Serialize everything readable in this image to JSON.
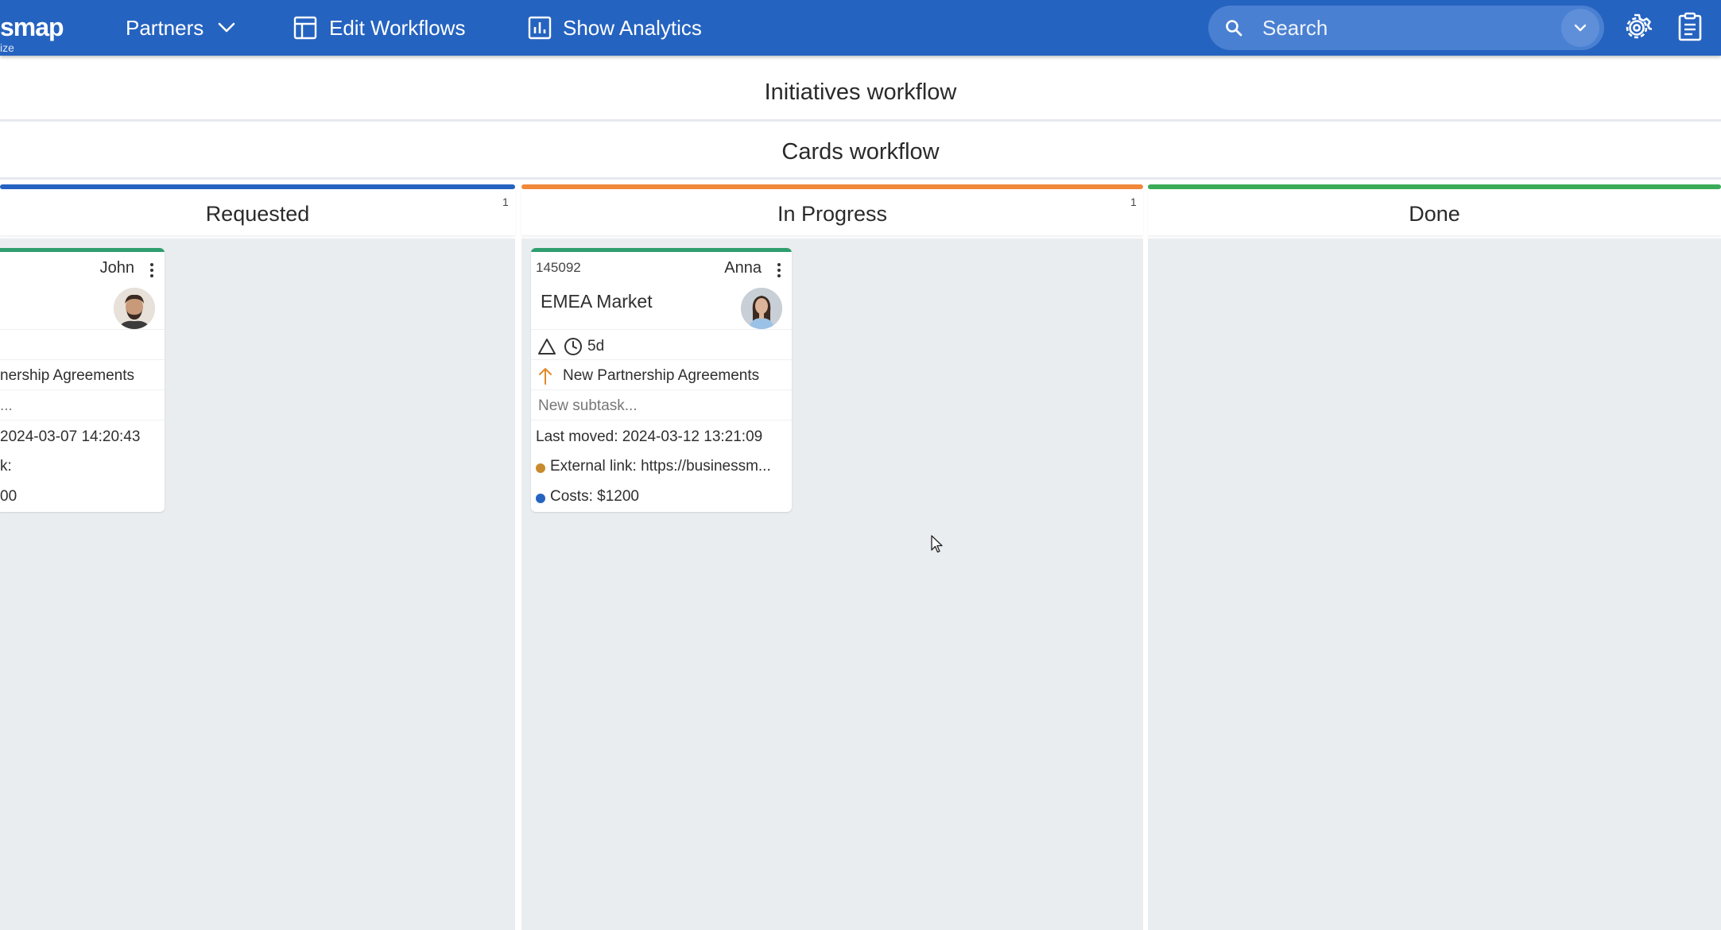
{
  "header": {
    "logo_text": "smap",
    "logo_sub": "ize",
    "nav": {
      "partners_label": "Partners",
      "edit_workflows_label": "Edit Workflows",
      "show_analytics_label": "Show Analytics"
    },
    "search": {
      "placeholder": "Search",
      "value": ""
    },
    "accent_color": "#2563c0"
  },
  "workflows": {
    "initiatives_title": "Initiatives workflow",
    "cards_title": "Cards workflow"
  },
  "columns": [
    {
      "name": "Requested",
      "count": "1",
      "color": "#2563c0"
    },
    {
      "name": "In Progress",
      "count": "1",
      "color": "#f0883a"
    },
    {
      "name": "Done",
      "count": "",
      "color": "#3bab57"
    }
  ],
  "cards": {
    "requested": {
      "owner": "John",
      "initiative": "nership Agreements",
      "subtask_placeholder": "...",
      "last_moved": "2024-03-07 14:20:43",
      "field_link": "k:",
      "field_costs": "00"
    },
    "in_progress": {
      "id": "145092",
      "owner": "Anna",
      "title": "EMEA Market",
      "age": "5d",
      "initiative": "New Partnership Agreements",
      "subtask_placeholder": "New subtask...",
      "last_moved_label": "Last moved:",
      "last_moved": "2024-03-12 13:21:09",
      "external_link_label": "External link:",
      "external_link_value": "https://businessm...",
      "costs_label": "Costs:",
      "costs_value": "$1200",
      "link_dot_color": "#c98a2e",
      "costs_dot_color": "#2563c0"
    }
  }
}
